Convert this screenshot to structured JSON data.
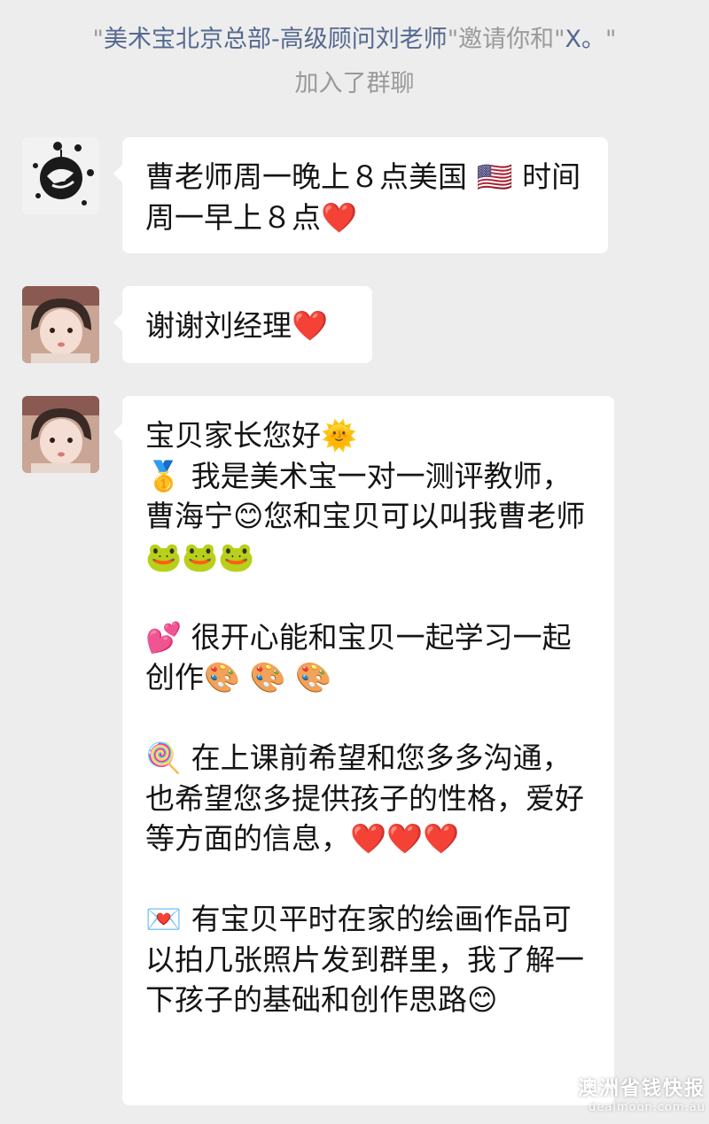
{
  "system_notice": {
    "q1": "\"",
    "inviter": "美术宝北京总部-高级顾问刘老师",
    "q2": "\"邀请你和\"",
    "invitee": "X。",
    "q3": "\"",
    "line2": "加入了群聊"
  },
  "messages": [
    {
      "avatar_icon": "ink-illustration-avatar-icon",
      "text": "曹老师周一晚上８点美国 🇺🇸 时间周一早上８点❤️"
    },
    {
      "avatar_icon": "child-photo-avatar-icon",
      "text": "谢谢刘经理❤️"
    },
    {
      "avatar_icon": "child-photo-avatar-icon",
      "text": "宝贝家长您好🌞\n🥇 我是美术宝一对一测评教师，曹海宁😊您和宝贝可以叫我曹老师🐸🐸🐸\n\n💕 很开心能和宝贝一起学习一起创作🎨 🎨 🎨\n\n🍭 在上课前希望和您多多沟通，也希望您多提供孩子的性格，爱好等方面的信息，❤️❤️❤️\n\n💌 有宝贝平时在家的绘画作品可以拍几张照片发到群里，我了解一下孩子的基础和创作思路😊"
    }
  ],
  "watermark": {
    "cn": "澳洲省钱快报",
    "en": "dealmoon.com.au"
  }
}
